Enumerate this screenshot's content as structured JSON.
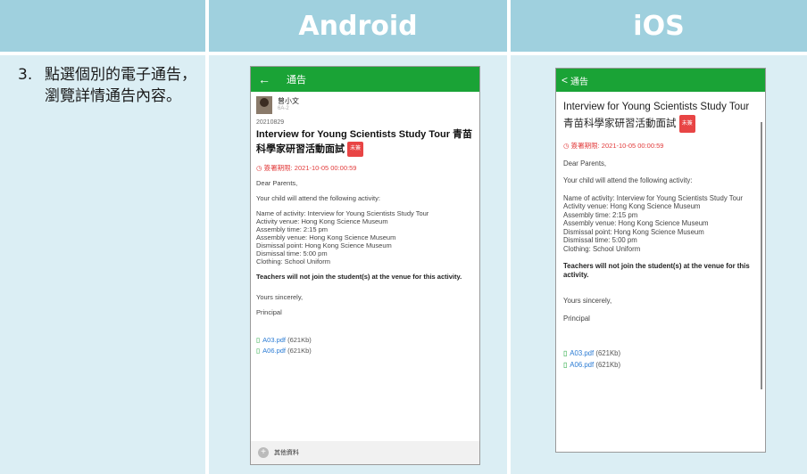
{
  "header": {
    "col1": "",
    "col2": "Android",
    "col3": "iOS"
  },
  "step": {
    "number": "3.",
    "text": "點選個別的電子通告，瀏覽詳情通告內容。"
  },
  "android": {
    "appbar_title": "通告",
    "sender_name": "曾小文",
    "sender_sub": "6A-2",
    "date": "20210829",
    "title": "Interview for Young Scientists Study Tour 青苗科學家研習活動面試",
    "badge": "未簽",
    "deadline": "簽署期限: 2021-10-05 00:00:59",
    "greeting": "Dear Parents,",
    "intro": "Your child will attend the following activity:",
    "details": [
      "Name of activity: Interview for Young Scientists Study Tour",
      "Activity venue: Hong Kong Science Museum",
      "Assembly time: 2:15 pm",
      "Assembly venue: Hong Kong Science Museum",
      "Dismissal point: Hong Kong Science Museum",
      "Dismissal time: 5:00 pm",
      "Clothing: School Uniform"
    ],
    "note": "Teachers will not join the student(s) at the venue for this activity.",
    "closing": "Yours sincerely,",
    "signature": "Principal",
    "attachments": [
      {
        "name": "A03.pdf",
        "size": "(621Kb)"
      },
      {
        "name": "A06.pdf",
        "size": "(621Kb)"
      }
    ],
    "footer": "其他資料"
  },
  "ios": {
    "appbar_title": "通告",
    "title": "Interview for Young Scientists Study Tour 青苗科學家研習活動面試",
    "badge": "未簽",
    "deadline": "簽署期限: 2021-10-05 00:00:59",
    "greeting": "Dear Parents,",
    "intro": "Your child will attend the following activity:",
    "details": [
      "Name of activity: Interview for Young Scientists Study Tour",
      "Activity venue: Hong Kong Science Museum",
      "Assembly time: 2:15 pm",
      "Assembly venue: Hong Kong Science Museum",
      "Dismissal point: Hong Kong Science Museum",
      "Dismissal time: 5:00 pm",
      "Clothing: School Uniform"
    ],
    "note": "Teachers will not join the student(s) at the venue for this activity.",
    "closing": "Yours sincerely,",
    "signature": "Principal",
    "attachments": [
      {
        "name": "A03.pdf",
        "size": "(621Kb)"
      },
      {
        "name": "A06.pdf",
        "size": "(621Kb)"
      }
    ]
  },
  "colors": {
    "header_bg": "#9fd0de",
    "cell_bg": "#dbeef4",
    "appbar": "#1aa336",
    "deadline": "#e23c3c"
  }
}
